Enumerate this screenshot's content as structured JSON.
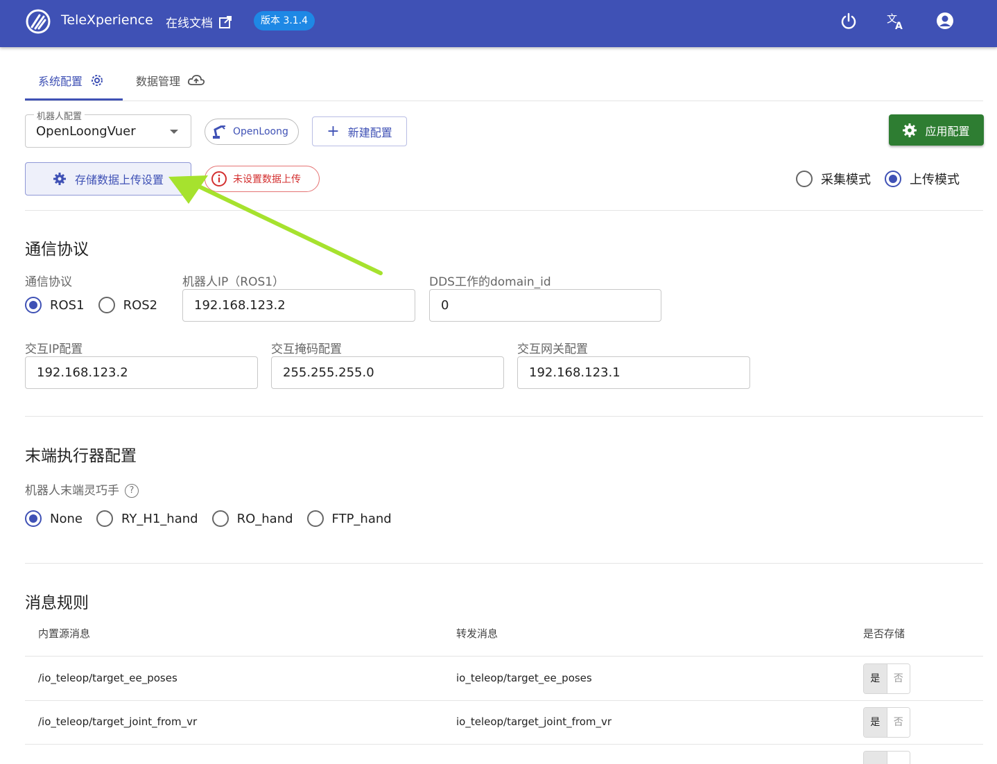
{
  "appbar": {
    "title": "TeleXperience",
    "docs_label": "在线文档",
    "version": "版本 3.1.4",
    "icons": [
      "power-icon",
      "translate-icon",
      "account-icon"
    ]
  },
  "tabs": [
    {
      "label": "系统配置",
      "icon": "gear-icon",
      "active": true
    },
    {
      "label": "数据管理",
      "icon": "cloud-upload-icon",
      "active": false
    }
  ],
  "robot_config": {
    "legend": "机器人配置",
    "value": "OpenLoongVuer",
    "chip": "OpenLoong",
    "new_button": "新建配置",
    "apply_button": "应用配置",
    "storage_button": "存储数据上传设置",
    "warning_chip": "未设置数据上传"
  },
  "mode": {
    "options": [
      "采集模式",
      "上传模式"
    ],
    "selected": "上传模式"
  },
  "comm": {
    "section_title": "通信协议",
    "protocol_label": "通信协议",
    "protocol_options": [
      "ROS1",
      "ROS2"
    ],
    "protocol_selected": "ROS1",
    "robot_ip_label": "机器人IP（ROS1）",
    "robot_ip": "192.168.123.2",
    "dds_label": "DDS工作的domain_id",
    "dds_value": "0",
    "ip_label": "交互IP配置",
    "ip_value": "192.168.123.2",
    "mask_label": "交互掩码配置",
    "mask_value": "255.255.255.0",
    "gateway_label": "交互网关配置",
    "gateway_value": "192.168.123.1"
  },
  "end_effector": {
    "section_title": "末端执行器配置",
    "label": "机器人末端灵巧手",
    "options": [
      "None",
      "RY_H1_hand",
      "RO_hand",
      "FTP_hand"
    ],
    "selected": "None"
  },
  "messages": {
    "section_title": "消息规则",
    "headers": [
      "内置源消息",
      "转发消息",
      "是否存储"
    ],
    "rows": [
      {
        "source": "/io_teleop/target_ee_poses",
        "forward": "io_teleop/target_ee_poses",
        "yes": "是",
        "no": "否",
        "stored": true
      },
      {
        "source": "/io_teleop/target_joint_from_vr",
        "forward": "io_teleop/target_joint_from_vr",
        "yes": "是",
        "no": "否",
        "stored": true
      }
    ]
  },
  "colors": {
    "primary": "#3f51b5",
    "apply_green": "#2e7d32",
    "warning_red": "#d32f2f",
    "annotation_arrow": "#a6e22e"
  }
}
